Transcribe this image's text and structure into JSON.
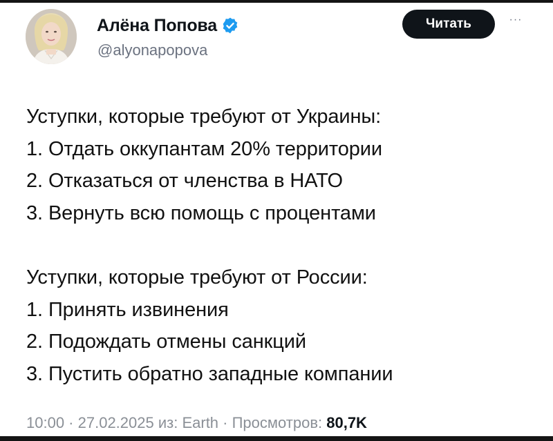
{
  "author": {
    "display_name": "Алёна Попова",
    "handle": "@alyonapopova",
    "verified": true
  },
  "actions": {
    "follow_label": "Читать",
    "more_label": "···"
  },
  "tweet": {
    "paragraphs": [
      {
        "lines": [
          "Уступки, которые требуют от Украины:",
          "1. Отдать оккупантам 20% территории",
          "2. Отказаться от членства в НАТО",
          "3. Вернуть всю помощь с процентами"
        ]
      },
      {
        "lines": [
          "Уступки, которые требуют от России:",
          "1. Принять извинения",
          "2. Подождать отмены санкций",
          "3. Пустить обратно западные компании"
        ]
      }
    ]
  },
  "meta": {
    "time": "10:00",
    "separator": " · ",
    "date": "27.02.2025",
    "source_prefix": " из: ",
    "source": "Earth",
    "views_label": "Просмотров: ",
    "views_count": "80,7K"
  },
  "colors": {
    "verified": "#1d9bf0",
    "follow_bg": "#0f1419",
    "muted_text": "#6b7280"
  }
}
